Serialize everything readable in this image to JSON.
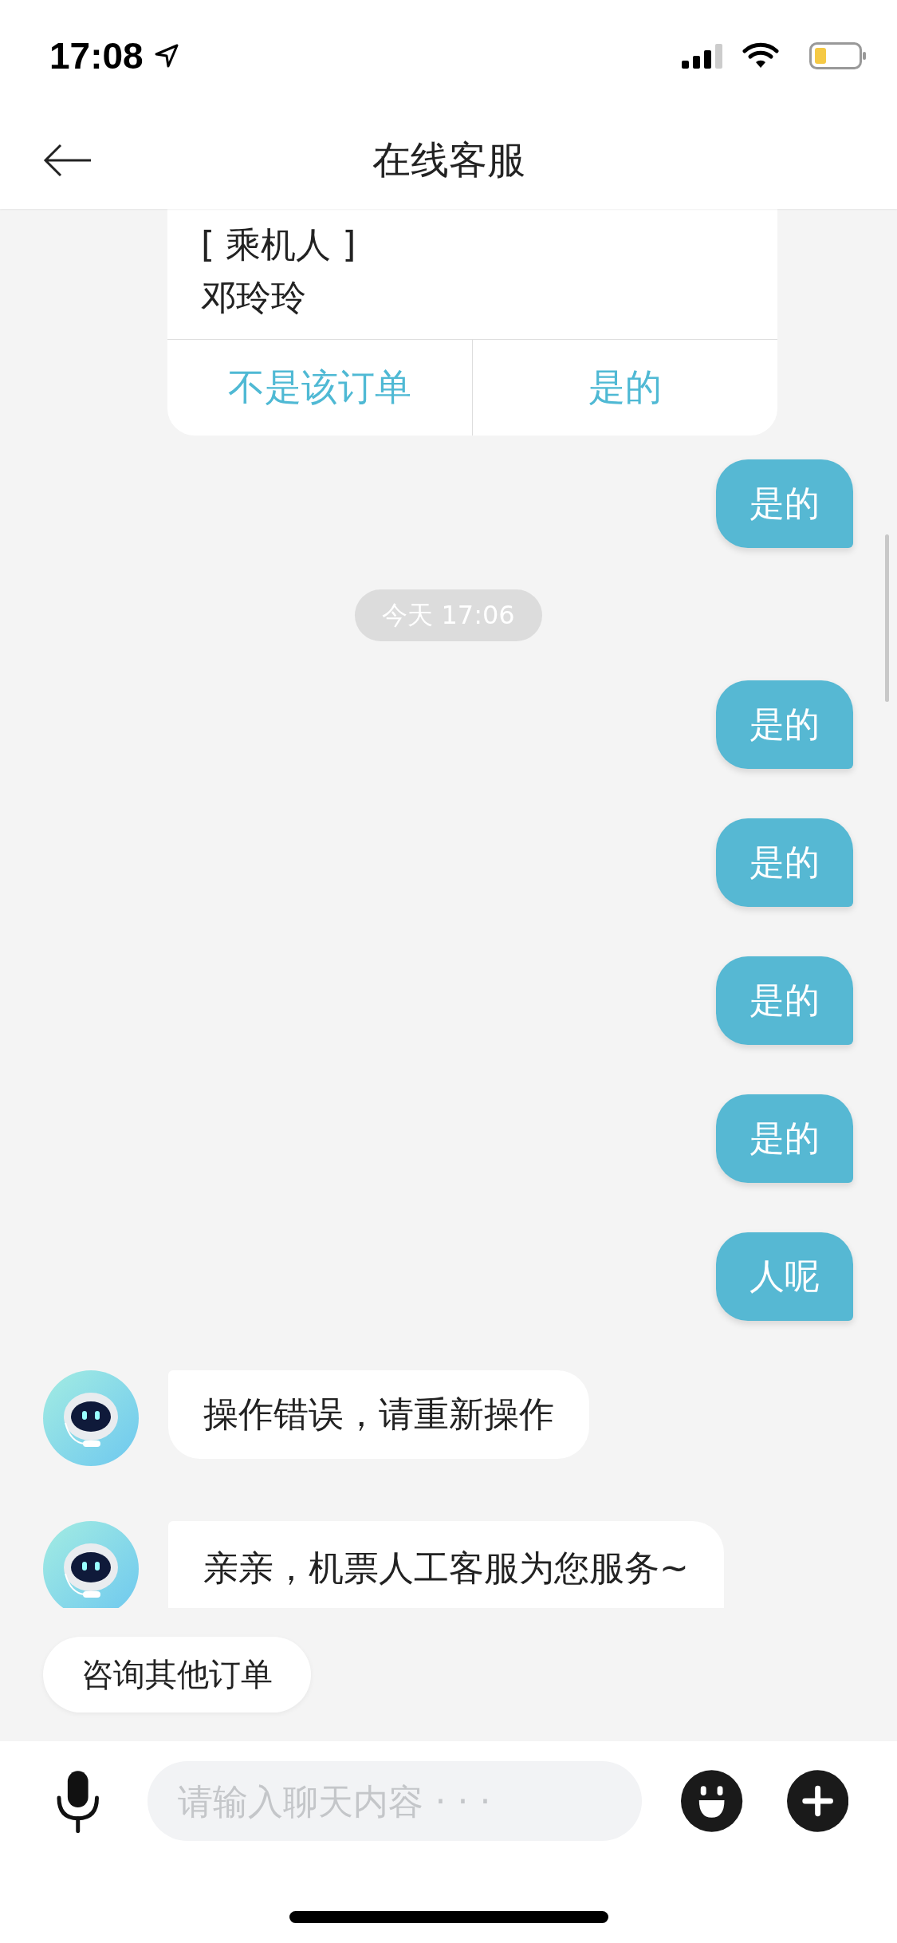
{
  "status_bar": {
    "time": "17:08"
  },
  "header": {
    "title": "在线客服"
  },
  "messages": [
    {
      "kind": "order_card",
      "lines": [
        "[ 乘机人 ]",
        "邓玲玲"
      ],
      "actions": [
        "不是该订单",
        "是的"
      ]
    },
    {
      "kind": "user",
      "text": "是的"
    },
    {
      "kind": "timestamp",
      "text": "今天 17:06"
    },
    {
      "kind": "user",
      "text": "是的"
    },
    {
      "kind": "user",
      "text": "是的"
    },
    {
      "kind": "user",
      "text": "是的"
    },
    {
      "kind": "user",
      "text": "是的"
    },
    {
      "kind": "user",
      "text": "人呢"
    },
    {
      "kind": "bot",
      "text": "操作错误，请重新操作"
    },
    {
      "kind": "bot",
      "text": "亲亲，机票人工客服为您服务~"
    }
  ],
  "quick_replies": [
    "咨询其他订单"
  ],
  "input": {
    "placeholder": "请输入聊天内容 · · ·"
  }
}
